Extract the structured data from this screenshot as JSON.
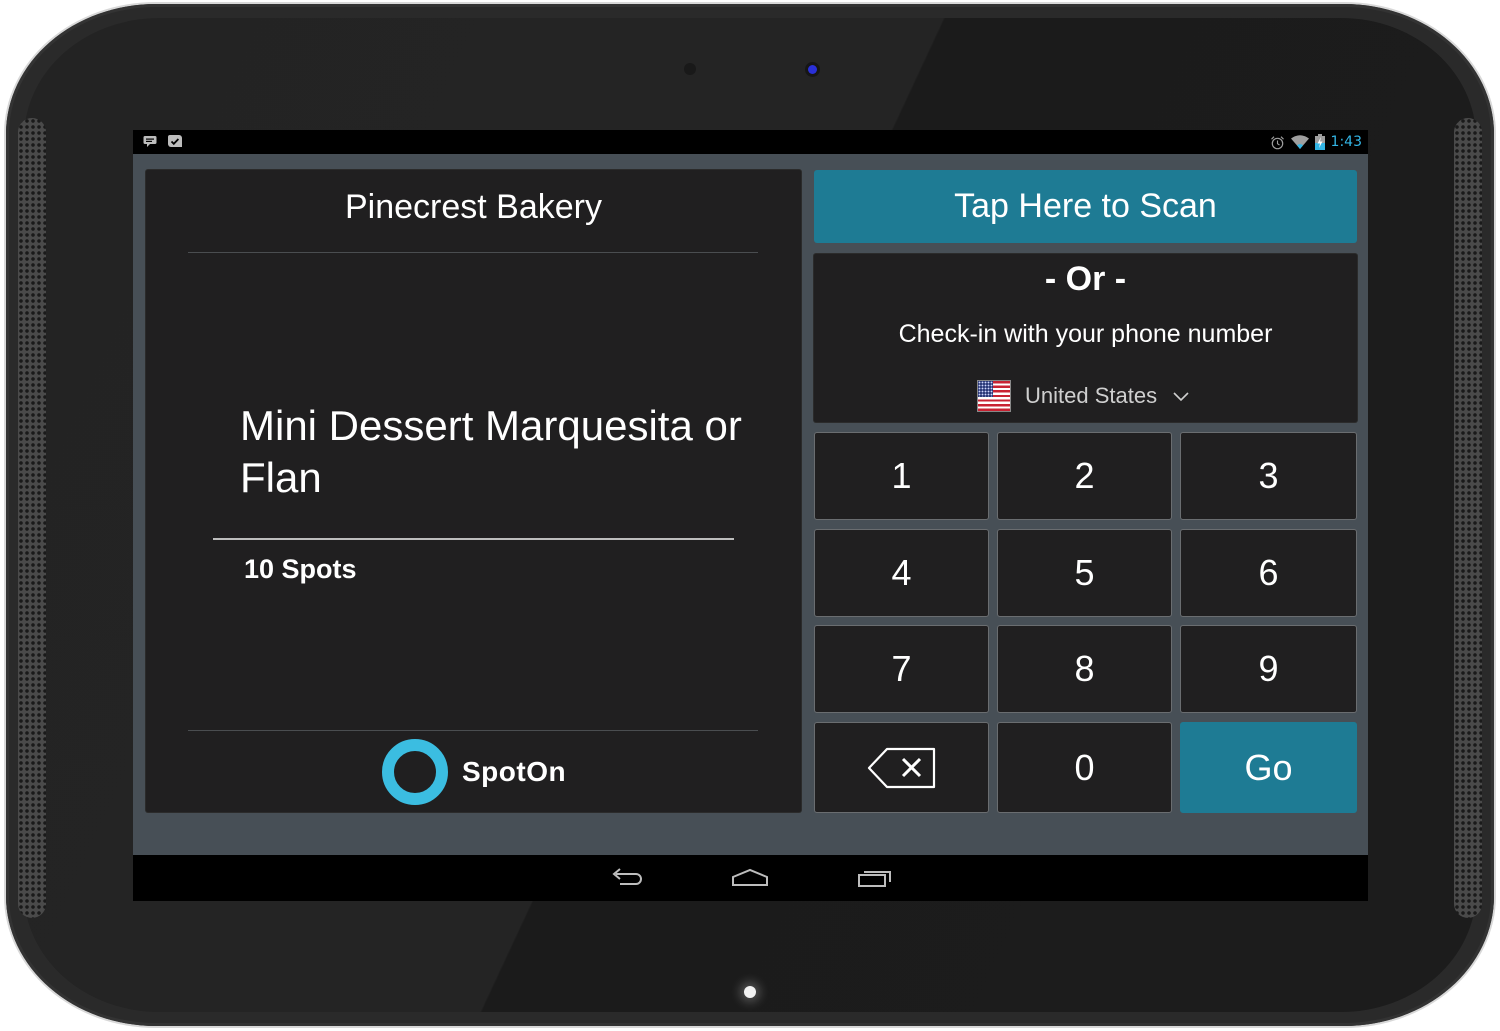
{
  "device": {
    "speaker_icons": [
      "speaker-grille-left",
      "speaker-grille-right"
    ]
  },
  "status_bar": {
    "left_icons": [
      "chat-notification-icon",
      "task-check-notification-icon"
    ],
    "right_icons": [
      "alarm-icon",
      "wifi-icon",
      "battery-charging-icon"
    ],
    "time": "1:43",
    "time_color": "#33b5e5"
  },
  "left_panel": {
    "merchant_name": "Pinecrest Bakery",
    "reward_title": "Mini Dessert Marquesita or Flan",
    "reward_points": "10 Spots",
    "brand_name": "SpotOn",
    "brand_color": "#3bbde1"
  },
  "right_panel": {
    "scan_button_label": "Tap Here to Scan",
    "or_label": "- Or -",
    "checkin_label": "Check-in with your phone number",
    "country": {
      "selected": "United States",
      "flag": "us-flag-icon"
    },
    "accent_color": "#1e7b94",
    "keypad": {
      "keys": [
        "1",
        "2",
        "3",
        "4",
        "5",
        "6",
        "7",
        "8",
        "9",
        "backspace",
        "0",
        "Go"
      ],
      "go_label": "Go"
    }
  },
  "nav_bar": {
    "buttons": [
      "back",
      "home",
      "recent-apps"
    ]
  }
}
